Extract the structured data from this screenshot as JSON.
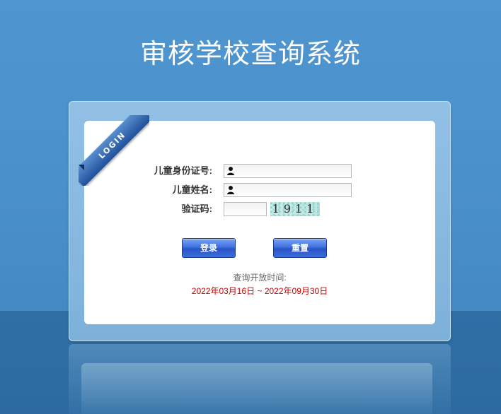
{
  "page": {
    "title": "审核学校查询系统"
  },
  "login_badge": {
    "text": "LOGIN"
  },
  "form": {
    "id_label": "儿童身份证号:",
    "id_value": "",
    "name_label": "儿童姓名:",
    "name_value": "",
    "captcha_label": "验证码:",
    "captcha_value": "",
    "captcha_image_text": "1911"
  },
  "buttons": {
    "login_label": "登录",
    "reset_label": "重置"
  },
  "query_period": {
    "label": "查询开放时间:",
    "range": "2022年03月16日 ~ 2022年09月30日"
  },
  "icons": {
    "id_field_icon": "person-icon",
    "name_field_icon": "person-icon"
  },
  "colors": {
    "background": "#4c93cd",
    "button": "#3f70e0",
    "date_range": "#cc0000"
  }
}
